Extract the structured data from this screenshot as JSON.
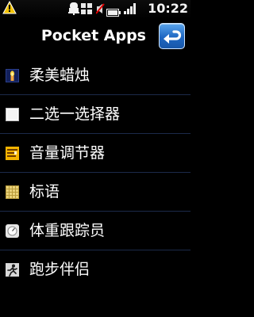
{
  "status_bar": {
    "time": "10:22",
    "icons": [
      "warning-icon",
      "alarm-icon",
      "grid-icon",
      "silent-icon",
      "battery-icon",
      "signal-icon"
    ]
  },
  "header": {
    "title": "Pocket Apps",
    "back_icon": "back-arrow-icon"
  },
  "apps": [
    {
      "label": "柔美蜡烛",
      "icon": "candle-icon"
    },
    {
      "label": "二选一选择器",
      "icon": "picker-icon"
    },
    {
      "label": "音量调节器",
      "icon": "volume-meter-icon"
    },
    {
      "label": "标语",
      "icon": "banner-icon"
    },
    {
      "label": "体重跟踪员",
      "icon": "scale-icon"
    },
    {
      "label": "跑步伴侣",
      "icon": "runner-icon"
    }
  ],
  "colors": {
    "background": "#000000",
    "accent": "#1e67c2",
    "divider": "#1c2a4a",
    "text": "#ffffff"
  }
}
